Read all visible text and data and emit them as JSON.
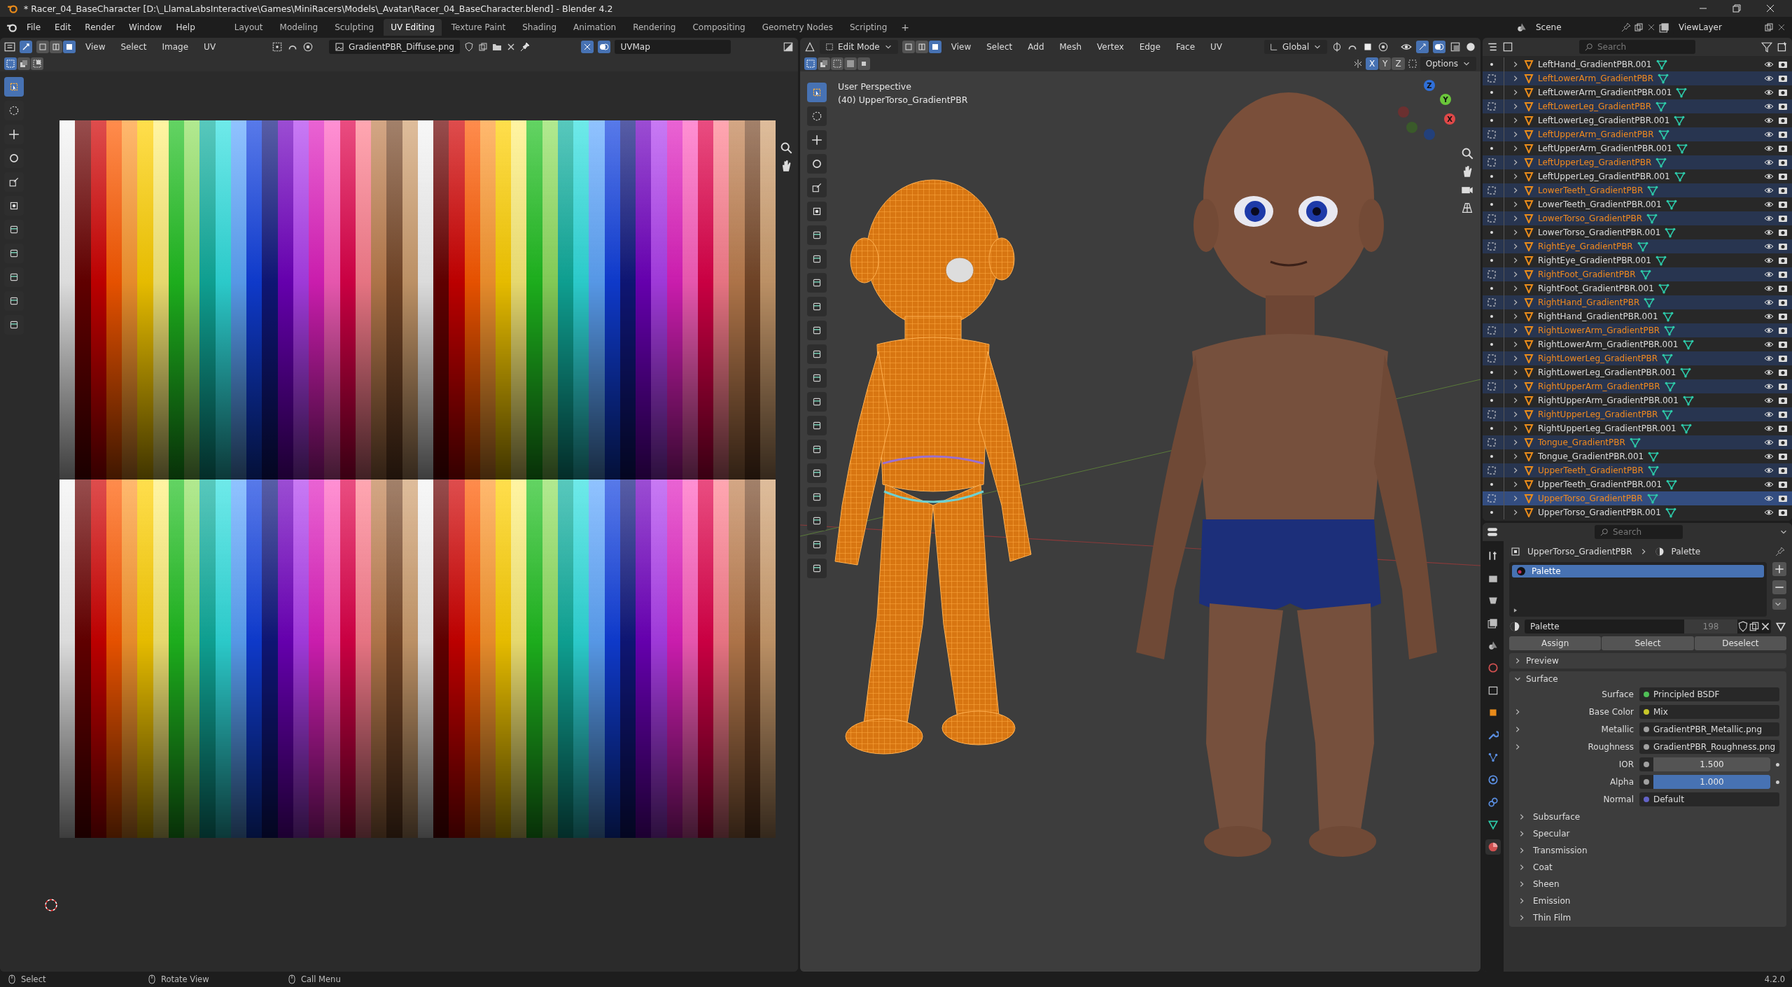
{
  "window": {
    "title": "* Racer_04_BaseCharacter [D:\\_LlamaLabsInteractive\\Games\\MiniRacers\\Models\\_Avatar\\Racer_04_BaseCharacter.blend] - Blender 4.2"
  },
  "menu": [
    "File",
    "Edit",
    "Render",
    "Window",
    "Help"
  ],
  "workspaces": [
    {
      "label": "Layout",
      "selected": false
    },
    {
      "label": "Modeling",
      "selected": false
    },
    {
      "label": "Sculpting",
      "selected": false
    },
    {
      "label": "UV Editing",
      "selected": true
    },
    {
      "label": "Texture Paint",
      "selected": false
    },
    {
      "label": "Shading",
      "selected": false
    },
    {
      "label": "Animation",
      "selected": false
    },
    {
      "label": "Rendering",
      "selected": false
    },
    {
      "label": "Compositing",
      "selected": false
    },
    {
      "label": "Geometry Nodes",
      "selected": false
    },
    {
      "label": "Scripting",
      "selected": false
    }
  ],
  "add_workspace": "+",
  "scene": "Scene",
  "view_layer": "ViewLayer",
  "uv_editor": {
    "menus": [
      "View",
      "Select",
      "Image",
      "UV"
    ],
    "image": "GradientPBR_Diffuse.png",
    "uv_map": "UVMap"
  },
  "viewport": {
    "mode": "Edit Mode",
    "menus": [
      "View",
      "Select",
      "Add",
      "Mesh",
      "Vertex",
      "Edge",
      "Face",
      "UV"
    ],
    "orientation": "Global",
    "mirror_axes": [
      {
        "label": "X",
        "on": true
      },
      {
        "label": "Y",
        "on": false
      },
      {
        "label": "Z",
        "on": false
      }
    ],
    "options": "Options",
    "overlay_lines": [
      "User Perspective",
      "(40) UpperTorso_GradientPBR"
    ],
    "gizmo_axes": [
      "Z",
      "Y",
      "X"
    ]
  },
  "outliner": {
    "search": {
      "placeholder": "Search"
    },
    "items": [
      {
        "name": "LeftHand_GradientPBR.001",
        "selected": false,
        "active": false
      },
      {
        "name": "LeftLowerArm_GradientPBR",
        "selected": true,
        "active": false
      },
      {
        "name": "LeftLowerArm_GradientPBR.001",
        "selected": false,
        "active": false
      },
      {
        "name": "LeftLowerLeg_GradientPBR",
        "selected": true,
        "active": false
      },
      {
        "name": "LeftLowerLeg_GradientPBR.001",
        "selected": false,
        "active": false
      },
      {
        "name": "LeftUpperArm_GradientPBR",
        "selected": true,
        "active": false
      },
      {
        "name": "LeftUpperArm_GradientPBR.001",
        "selected": false,
        "active": false
      },
      {
        "name": "LeftUpperLeg_GradientPBR",
        "selected": true,
        "active": false
      },
      {
        "name": "LeftUpperLeg_GradientPBR.001",
        "selected": false,
        "active": false
      },
      {
        "name": "LowerTeeth_GradientPBR",
        "selected": true,
        "active": false
      },
      {
        "name": "LowerTeeth_GradientPBR.001",
        "selected": false,
        "active": false
      },
      {
        "name": "LowerTorso_GradientPBR",
        "selected": true,
        "active": false
      },
      {
        "name": "LowerTorso_GradientPBR.001",
        "selected": false,
        "active": false
      },
      {
        "name": "RightEye_GradientPBR",
        "selected": true,
        "active": false
      },
      {
        "name": "RightEye_GradientPBR.001",
        "selected": false,
        "active": false
      },
      {
        "name": "RightFoot_GradientPBR",
        "selected": true,
        "active": false
      },
      {
        "name": "RightFoot_GradientPBR.001",
        "selected": false,
        "active": false
      },
      {
        "name": "RightHand_GradientPBR",
        "selected": true,
        "active": false
      },
      {
        "name": "RightHand_GradientPBR.001",
        "selected": false,
        "active": false
      },
      {
        "name": "RightLowerArm_GradientPBR",
        "selected": true,
        "active": false
      },
      {
        "name": "RightLowerArm_GradientPBR.001",
        "selected": false,
        "active": false
      },
      {
        "name": "RightLowerLeg_GradientPBR",
        "selected": true,
        "active": false
      },
      {
        "name": "RightLowerLeg_GradientPBR.001",
        "selected": false,
        "active": false
      },
      {
        "name": "RightUpperArm_GradientPBR",
        "selected": true,
        "active": false
      },
      {
        "name": "RightUpperArm_GradientPBR.001",
        "selected": false,
        "active": false
      },
      {
        "name": "RightUpperLeg_GradientPBR",
        "selected": true,
        "active": false
      },
      {
        "name": "RightUpperLeg_GradientPBR.001",
        "selected": false,
        "active": false
      },
      {
        "name": "Tongue_GradientPBR",
        "selected": true,
        "active": false
      },
      {
        "name": "Tongue_GradientPBR.001",
        "selected": false,
        "active": false
      },
      {
        "name": "UpperTeeth_GradientPBR",
        "selected": true,
        "active": false
      },
      {
        "name": "UpperTeeth_GradientPBR.001",
        "selected": false,
        "active": false
      },
      {
        "name": "UpperTorso_GradientPBR",
        "selected": true,
        "active": true
      },
      {
        "name": "UpperTorso_GradientPBR.001",
        "selected": false,
        "active": false
      }
    ]
  },
  "properties": {
    "search": {
      "placeholder": "Search"
    },
    "object": "UpperTorso_GradientPBR",
    "material": "Palette",
    "slots": [
      {
        "name": "Palette",
        "selected": true
      }
    ],
    "material_name": "Palette",
    "users": "198",
    "slot_buttons": [
      "Assign",
      "Select",
      "Deselect"
    ],
    "panels": [
      {
        "title": "Preview",
        "expanded": false
      },
      {
        "title": "Surface",
        "expanded": true
      }
    ],
    "surface_rows": [
      {
        "kind": "link",
        "label": "Surface",
        "value": "Principled BSDF",
        "color": "#4fbf56",
        "expandable": false
      },
      {
        "kind": "link",
        "label": "Base Color",
        "value": "Mix",
        "color": "#c7c729",
        "expandable": true
      },
      {
        "kind": "link",
        "label": "Metallic",
        "value": "GradientPBR_Metallic.png",
        "color": "#a1a1a1",
        "expandable": true
      },
      {
        "kind": "link",
        "label": "Roughness",
        "value": "GradientPBR_Roughness.png",
        "color": "#a1a1a1",
        "expandable": true
      },
      {
        "kind": "number",
        "label": "IOR",
        "value": "1.500",
        "color": "#a1a1a1",
        "expandable": false
      },
      {
        "kind": "slider",
        "label": "Alpha",
        "value": "1.000",
        "color": "#a1a1a1",
        "expandable": false,
        "level": 1
      },
      {
        "kind": "link",
        "label": "Normal",
        "value": "Default",
        "color": "#6363c7",
        "expandable": false
      }
    ],
    "subpanels": [
      "Subsurface",
      "Specular",
      "Transmission",
      "Coat",
      "Sheen",
      "Emission",
      "Thin Film"
    ]
  },
  "status_bar": {
    "hints": [
      "Select",
      "Rotate View",
      "Call Menu"
    ],
    "version": "4.2.0"
  }
}
